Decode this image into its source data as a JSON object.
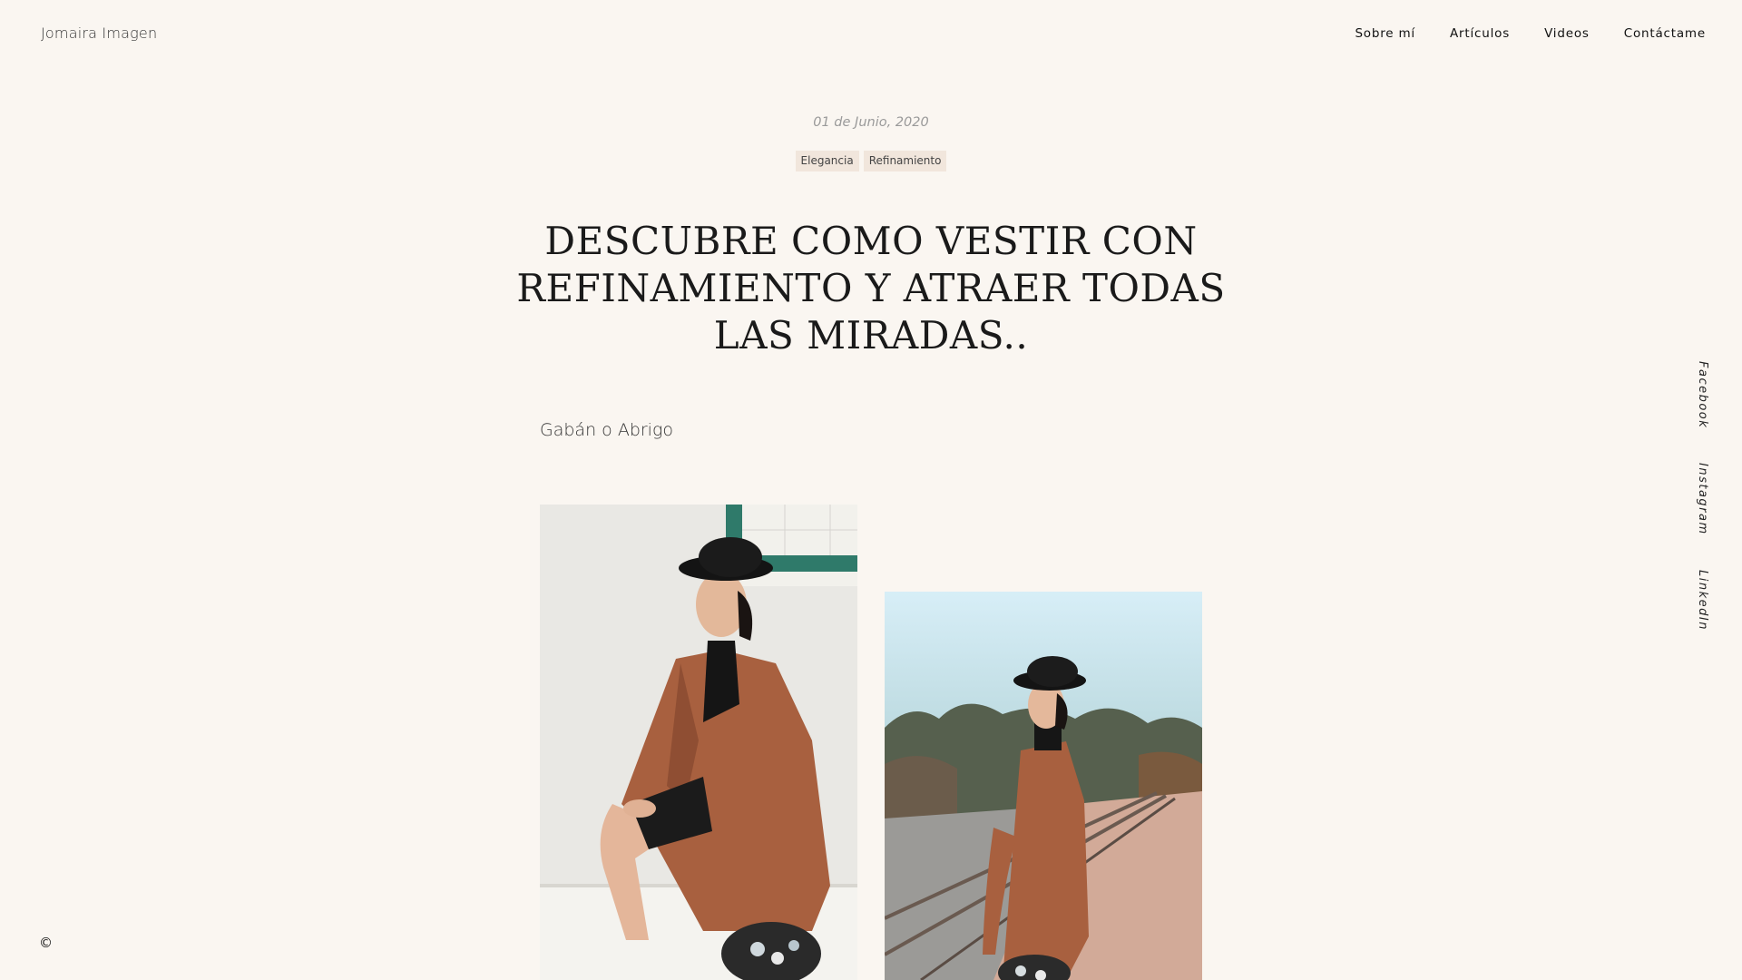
{
  "header": {
    "brand": "Jomaira Imagen",
    "nav": [
      "Sobre mí",
      "Artículos",
      "Videos",
      "Contáctame"
    ]
  },
  "article": {
    "date": "01 de Junio, 2020",
    "tags": [
      "Elegancia",
      "Refinamiento"
    ],
    "title_lines": [
      "DESCUBRE COMO VESTIR CON",
      "REFINAMIENTO Y ATRAER TODAS",
      "LAS MIRADAS.."
    ],
    "subtitle": "Gabán o Abrigo"
  },
  "social": [
    "Facebook",
    "Instagram",
    "LinkedIn"
  ],
  "footer": {
    "copyright": "©"
  },
  "colors": {
    "background": "#faf6f1",
    "tag_background": "#f1e6dc",
    "coat": "#a8603f",
    "tile_accent": "#2f7a6a"
  }
}
